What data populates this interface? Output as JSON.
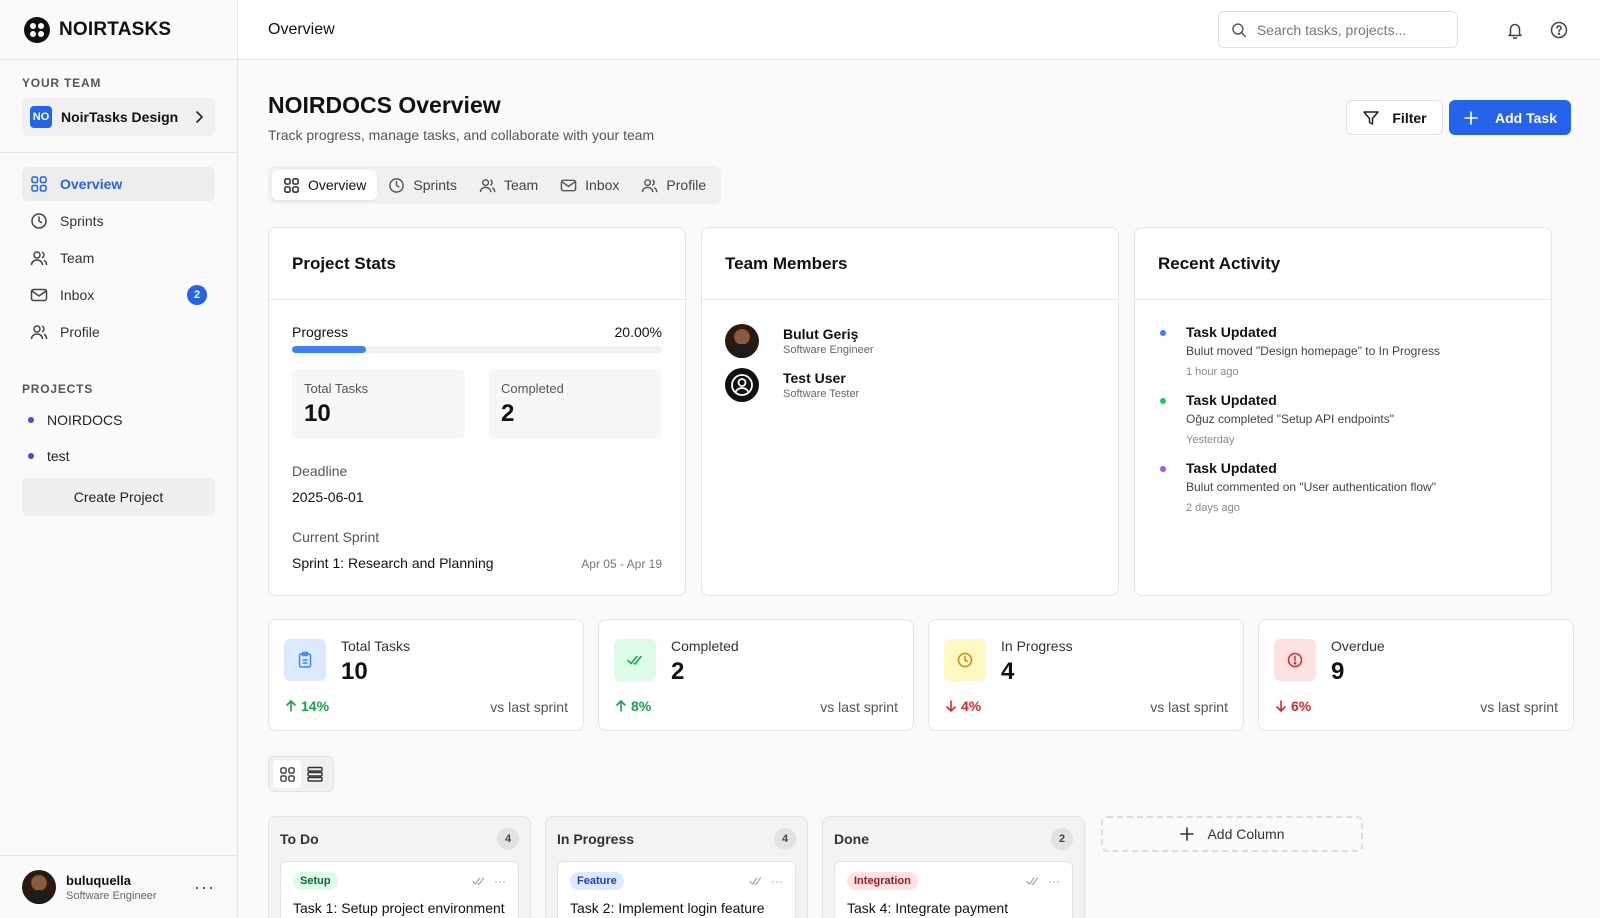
{
  "brand": {
    "name": "NOIRTASKS"
  },
  "sidebar": {
    "team_label": "YOUR TEAM",
    "team": {
      "abbr": "NO",
      "name": "NoirTasks Design"
    },
    "nav": [
      {
        "label": "Overview"
      },
      {
        "label": "Sprints"
      },
      {
        "label": "Team"
      },
      {
        "label": "Inbox",
        "badge": "2"
      },
      {
        "label": "Profile"
      }
    ],
    "projects_label": "PROJECTS",
    "projects": [
      {
        "name": "NOIRDOCS"
      },
      {
        "name": "test"
      }
    ],
    "create_label": "Create Project",
    "user": {
      "name": "buluquella",
      "role": "Software Engineer"
    }
  },
  "topbar": {
    "title": "Overview",
    "search_placeholder": "Search tasks, projects..."
  },
  "header": {
    "title": "NOIRDOCS Overview",
    "subtitle": "Track progress, manage tasks, and collaborate with your team",
    "filter_label": "Filter",
    "add_label": "Add Task"
  },
  "tabs": [
    {
      "label": "Overview"
    },
    {
      "label": "Sprints"
    },
    {
      "label": "Team"
    },
    {
      "label": "Inbox"
    },
    {
      "label": "Profile"
    }
  ],
  "project_stats": {
    "title": "Project Stats",
    "progress_label": "Progress",
    "progress_text": "20.00%",
    "progress_value": 0.2,
    "total_label": "Total Tasks",
    "total_value": "10",
    "completed_label": "Completed",
    "completed_value": "2",
    "deadline_label": "Deadline",
    "deadline_value": "2025-06-01",
    "sprint_label": "Current Sprint",
    "sprint_value": "Sprint 1: Research and Planning",
    "sprint_dates": "Apr 05 - Apr 19"
  },
  "team_members": {
    "title": "Team Members",
    "members": [
      {
        "name": "Bulut Geriş",
        "role": "Software Engineer"
      },
      {
        "name": "Test User",
        "role": "Software Tester"
      }
    ]
  },
  "recent_activity": {
    "title": "Recent Activity",
    "items": [
      {
        "title": "Task Updated",
        "desc": "Bulut moved \"Design homepage\" to In Progress",
        "time": "1 hour ago",
        "color": "#3b82f6"
      },
      {
        "title": "Task Updated",
        "desc": "Oğuz completed \"Setup API endpoints\"",
        "time": "Yesterday",
        "color": "#22c55e"
      },
      {
        "title": "Task Updated",
        "desc": "Bulut commented on \"User authentication flow\"",
        "time": "2 days ago",
        "color": "#a855f7"
      }
    ]
  },
  "stats": [
    {
      "label": "Total Tasks",
      "value": "10",
      "trend": "14%",
      "vs": "vs last sprint",
      "direction": "up"
    },
    {
      "label": "Completed",
      "value": "2",
      "trend": "8%",
      "vs": "vs last sprint",
      "direction": "up"
    },
    {
      "label": "In Progress",
      "value": "4",
      "trend": "4%",
      "vs": "vs last sprint",
      "direction": "down"
    },
    {
      "label": "Overdue",
      "value": "9",
      "trend": "6%",
      "vs": "vs last sprint",
      "direction": "down"
    }
  ],
  "board": {
    "columns": [
      {
        "title": "To Do",
        "count": "4",
        "task": {
          "tag": "Setup",
          "title": "Task 1: Setup project environment"
        }
      },
      {
        "title": "In Progress",
        "count": "4",
        "task": {
          "tag": "Feature",
          "title": "Task 2: Implement login feature"
        }
      },
      {
        "title": "Done",
        "count": "2",
        "task": {
          "tag": "Integration",
          "title": "Task 4: Integrate payment"
        }
      }
    ],
    "add_column_label": "Add Column"
  },
  "colors": {
    "accent": "#2563eb",
    "up": "#16a34a",
    "down": "#dc2626"
  }
}
